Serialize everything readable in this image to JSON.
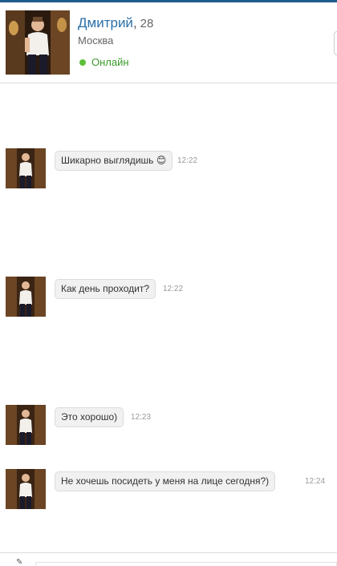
{
  "profile": {
    "name": "Дмитрий",
    "separator": ",",
    "age": "28",
    "city": "Москва",
    "status": "Онлайн",
    "status_color": "#5dbf3a"
  },
  "messages": [
    {
      "text": "Шикарно выглядишь 😊",
      "time": "12:22"
    },
    {
      "text": "Как день проходит?",
      "time": "12:22"
    },
    {
      "text": "Это хорошо)",
      "time": "12:23"
    },
    {
      "text": "Не хочешь посидеть у меня на лице сегодня?)",
      "time": "12:24"
    }
  ],
  "colors": {
    "accent": "#1f5d8c",
    "name": "#2b6fa8",
    "online": "#3a9a2a"
  }
}
